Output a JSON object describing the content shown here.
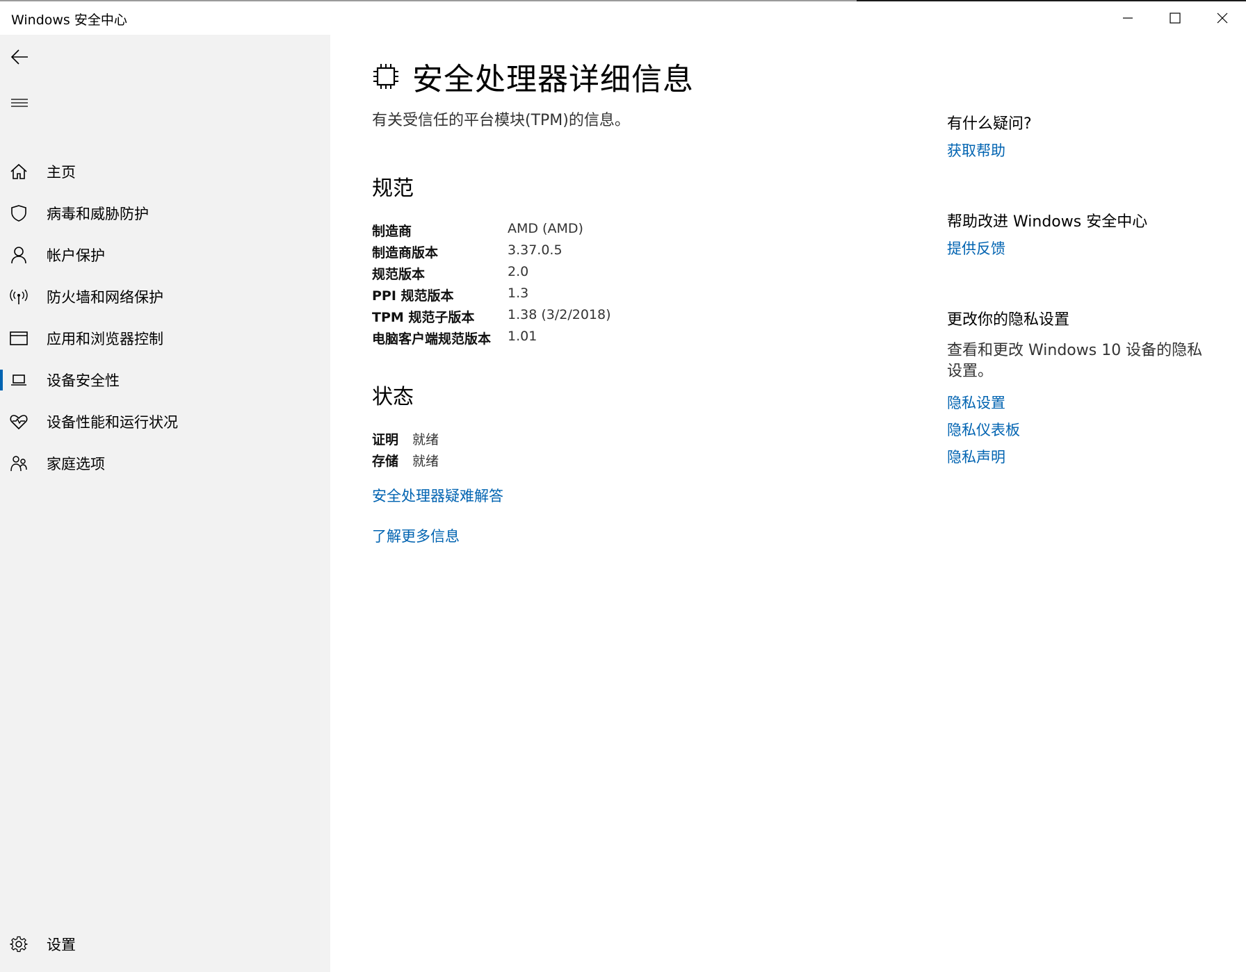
{
  "window": {
    "title": "Windows 安全中心"
  },
  "sidebar": {
    "items": [
      {
        "label": "主页",
        "icon": "home-icon"
      },
      {
        "label": "病毒和威胁防护",
        "icon": "shield-icon"
      },
      {
        "label": "帐户保护",
        "icon": "person-icon"
      },
      {
        "label": "防火墙和网络保护",
        "icon": "wireless-icon"
      },
      {
        "label": "应用和浏览器控制",
        "icon": "browser-window-icon"
      },
      {
        "label": "设备安全性",
        "icon": "laptop-icon",
        "selected": true
      },
      {
        "label": "设备性能和运行状况",
        "icon": "heart-pulse-icon"
      },
      {
        "label": "家庭选项",
        "icon": "family-icon"
      }
    ],
    "settings_label": "设置"
  },
  "main": {
    "title": "安全处理器详细信息",
    "description": "有关受信任的平台模块(TPM)的信息。",
    "spec_section": {
      "heading": "规范",
      "rows_a": [
        {
          "key": "制造商",
          "value": "AMD (AMD)"
        },
        {
          "key": "制造商版本",
          "value": "3.37.0.5"
        },
        {
          "key": "规范版本",
          "value": "2.0"
        }
      ],
      "rows_b": [
        {
          "key": "PPI 规范版本",
          "value": "1.3"
        },
        {
          "key": "TPM 规范子版本",
          "value": "1.38 (3/2/2018)"
        },
        {
          "key": "电脑客户端规范版本",
          "value": "1.01"
        }
      ]
    },
    "status_section": {
      "heading": "状态",
      "rows": [
        {
          "key": "证明",
          "value": "就绪"
        },
        {
          "key": "存储",
          "value": "就绪"
        }
      ]
    },
    "links": {
      "troubleshoot": "安全处理器疑难解答",
      "learn_more": "了解更多信息"
    }
  },
  "right_panel": {
    "question_heading": "有什么疑问?",
    "get_help": "获取帮助",
    "improve_heading": "帮助改进 Windows 安全中心",
    "feedback": "提供反馈",
    "privacy_heading": "更改你的隐私设置",
    "privacy_text": "查看和更改 Windows 10 设备的隐私设置。",
    "privacy_settings": "隐私设置",
    "privacy_dashboard": "隐私仪表板",
    "privacy_statement": "隐私声明"
  },
  "colors": {
    "accent": "#0063b1",
    "sidebar_bg": "#f2f2f2",
    "link": "#0063b1"
  }
}
